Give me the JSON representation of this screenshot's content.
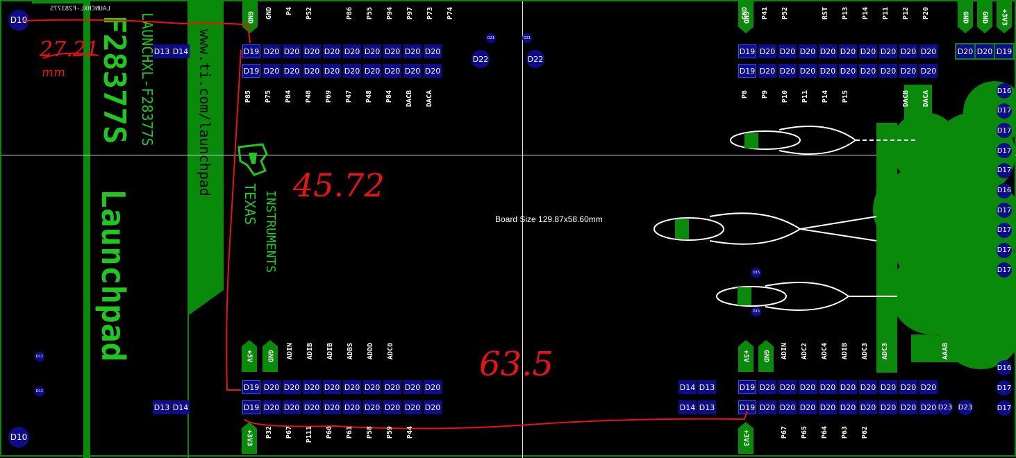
{
  "board": {
    "size_label": "Board Size 129.87x58.60mm",
    "silkscreen": {
      "main_title": "Launchpad",
      "part_number": "LAUNCHXL-F28377S",
      "big_number": "F28377S",
      "url": "www.ti.com/launchpad",
      "brand_line1": "TEXAS",
      "brand_line2": "INSTRUMENTS",
      "top_left_text": "LAUNCHXL-F28377S"
    },
    "corner_pads": {
      "top_left": "D10",
      "bottom_left": "D10"
    },
    "left_pads": {
      "row1": [
        "D13",
        "D14"
      ],
      "row2": [
        "D13",
        "D14"
      ]
    },
    "small_left": [
      "D12",
      "D12"
    ],
    "top_mid_pads": [
      "D22",
      "D22"
    ],
    "top_mid_small": [
      "D21",
      "D21"
    ],
    "middle_small": [
      "D15",
      "D15"
    ],
    "header_top_left": {
      "row1": [
        "D19",
        "D20",
        "D20",
        "D20",
        "D20",
        "D20",
        "D20",
        "D20",
        "D20",
        "D20"
      ],
      "row2": [
        "D19",
        "D20",
        "D20",
        "D20",
        "D20",
        "D20",
        "D20",
        "D20",
        "D20",
        "D20"
      ],
      "labels_above": [
        "GND",
        "P4",
        "P52",
        "",
        "P86",
        "P55",
        "P94",
        "P97",
        "P73",
        "P74"
      ],
      "gnd_tag": "GND",
      "labels_below": [
        "P85",
        "P75",
        "P84",
        "P48",
        "P69",
        "P47",
        "P48",
        "P84",
        "DACB",
        "DACA"
      ]
    },
    "header_top_right": {
      "row1": [
        "D19",
        "D20",
        "D20",
        "D20",
        "D20",
        "D20",
        "D20",
        "D20",
        "D20",
        "D20"
      ],
      "row2": [
        "D19",
        "D20",
        "D20",
        "D20",
        "D20",
        "D20",
        "D20",
        "D20",
        "D20",
        "D20"
      ],
      "labels_above": [
        "GND",
        "P41",
        "P52",
        "",
        "RST",
        "P13",
        "P14",
        "P11",
        "P12",
        "P20"
      ],
      "gnd_tag": "GND",
      "labels_below": [
        "P8",
        "P9",
        "P10",
        "P11",
        "P14",
        "P15",
        "",
        "",
        "DACB",
        "DACA"
      ]
    },
    "header_bottom_left": {
      "row1": [
        "D19",
        "D20",
        "D20",
        "D20",
        "D20",
        "D20",
        "D20",
        "D20",
        "D20",
        "D20"
      ],
      "row2": [
        "D19",
        "D20",
        "D20",
        "D20",
        "D20",
        "D20",
        "D20",
        "D20",
        "D20",
        "D20"
      ],
      "tags_above": [
        "+5V",
        "GND"
      ],
      "labels_above": [
        "ADIN",
        "ADIB",
        "ADIB",
        "ADBS",
        "ADDD",
        "ADC0"
      ],
      "tag_below": "+3V3",
      "labels_below": [
        "P32",
        "P67",
        "P111",
        "P60",
        "P61",
        "P58",
        "P59",
        "P44"
      ]
    },
    "header_bottom_right": {
      "row1": [
        "D19",
        "D20",
        "D20",
        "D20",
        "D20",
        "D20",
        "D20",
        "D20",
        "D20",
        "D20"
      ],
      "row2": [
        "D19",
        "D20",
        "D20",
        "D20",
        "D20",
        "D20",
        "D20",
        "D20",
        "D20",
        "D20"
      ],
      "tags_above": [
        "+5V",
        "GND"
      ],
      "labels_above": [
        "ADIN",
        "ADC2",
        "ADC4",
        "ADIB",
        "ADC3",
        "ADC3",
        "",
        "",
        "AAAB"
      ],
      "tag_below": "+3V3",
      "labels_below": [
        "P67",
        "P65",
        "P64",
        "P63",
        "P62"
      ]
    },
    "bottom_right_pads": {
      "row1": [
        "D14",
        "D13"
      ],
      "row2": [
        "D14",
        "D13"
      ],
      "extra": [
        "D23",
        "D23"
      ]
    },
    "right_column": {
      "tags": [
        "GND",
        "GND",
        "+3V3"
      ],
      "top_pads": [
        "D20",
        "D20",
        "D19"
      ],
      "pads": [
        "D16",
        "D17",
        "D17",
        "D17",
        "D17",
        "D16",
        "D17",
        "D17",
        "D17",
        "D17",
        "D16",
        "D17",
        "D17"
      ]
    },
    "annotations": {
      "width_note": "27.21",
      "width_unit": "mm",
      "height_note": "45.72",
      "length_note": "63.5"
    }
  }
}
